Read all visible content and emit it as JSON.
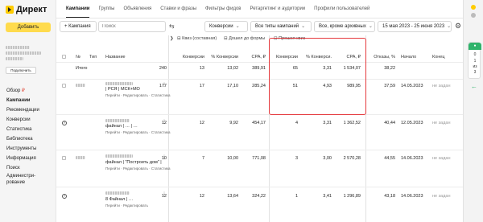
{
  "app": {
    "logo_text": "Директ"
  },
  "sidebar": {
    "add_button": "Добавить",
    "connect_button": "Подключить",
    "items": [
      {
        "label": "Обзор",
        "badge": "₽"
      },
      {
        "label": "Кампании",
        "active": true
      },
      {
        "label": "Рекомендации"
      },
      {
        "label": "Конверсии"
      },
      {
        "label": "Статистика"
      },
      {
        "label": "Библиотека"
      },
      {
        "label": "Инструменты"
      },
      {
        "label": "Информация"
      },
      {
        "label": "Поиск"
      },
      {
        "label": "Администри-"
      },
      {
        "label": "рование"
      }
    ]
  },
  "tabs": [
    "Кампании",
    "Группы",
    "Объявления",
    "Ставки и фразы",
    "Фильтры фидов",
    "Ретаргетинг и аудитории",
    "Профили пользователей"
  ],
  "toolbar": {
    "add_campaign": "+ Кампания",
    "search_placeholder": "Поиск",
    "conversions": "Конверсии",
    "all_campaign_types": "Все типы кампаний",
    "all_except_archived": "Все, кроме архивных",
    "date_range": "15 мая 2023 - 25 июня 2023"
  },
  "table": {
    "group_headers": {
      "kviz_composite": "Квиз (составная)",
      "before_form": "Дошел до формы",
      "passed_kviz": "Прошел квиз"
    },
    "columns": {
      "num": "№",
      "type": "Тип",
      "name": "Название",
      "conv1": "Конверсии",
      "pct1": "% Конверсии",
      "cpa1": "CPA, ₽",
      "conv2": "Конверсии",
      "pct2": "% Конверси.",
      "cpa2": "CPA, ₽",
      "refusals": "Отказы, %",
      "start": "Начало",
      "end": "Конец"
    },
    "total_row": {
      "label": "Итого",
      "c0": "240",
      "conv1": "13",
      "pct1": "13,02",
      "cpa1": "389,91",
      "conv2": "65",
      "pct2": "3,31",
      "cpa2": "1 534,07",
      "refusals": "38,22"
    },
    "rows": [
      {
        "c0": "177",
        "name": "| РСЯ | МСК+МО",
        "links": "Перейти · Редактировать · Статистика",
        "conv1": "17",
        "pct1": "17,10",
        "cpa1": "285,24",
        "conv2": "51",
        "pct2": "4,93",
        "cpa2": "989,95",
        "refusals": "37,59",
        "start": "14.05.2023",
        "end": "не задан"
      },
      {
        "c0": "12",
        "name": "файнал | … | …",
        "links": "Перейти · Редактировать · Статистика",
        "conv1": "12",
        "pct1": "9,92",
        "cpa1": "454,17",
        "conv2": "4",
        "pct2": "3,31",
        "cpa2": "1 362,52",
        "refusals": "40,44",
        "start": "12.05.2023",
        "end": "не задан"
      },
      {
        "c0": "10",
        "name": "файнал | \"Построить дом\" |",
        "links": "Перейти · Редактировать · Статистика",
        "conv1": "7",
        "pct1": "10,00",
        "cpa1": "771,08",
        "conv2": "3",
        "pct2": "3,00",
        "cpa2": "2 570,28",
        "refusals": "44,55",
        "start": "14.06.2023",
        "end": "не задан"
      },
      {
        "c0": "12",
        "name": "8 Файнал | …",
        "links": "Перейти · Редактировать",
        "conv1": "12",
        "pct1": "13,64",
        "cpa1": "324,22",
        "conv2": "1",
        "pct2": "3,41",
        "cpa2": "1 296,89",
        "refusals": "43,18",
        "start": "14.06.2023",
        "end": "не задан"
      }
    ]
  },
  "rail": {
    "n1": "0",
    "n2": "1",
    "n3": "из",
    "n4": "3"
  },
  "colors": {
    "accent": "#ffdb4d",
    "highlight": "#e5393d",
    "green": "#2fb36b"
  }
}
